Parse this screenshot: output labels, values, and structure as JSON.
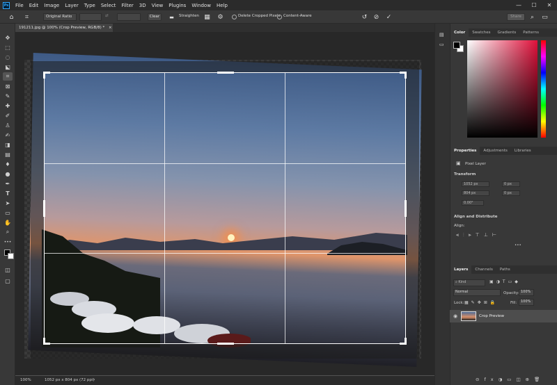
{
  "menubar": {
    "logo": "Ps",
    "items": [
      "File",
      "Edit",
      "Image",
      "Layer",
      "Type",
      "Select",
      "Filter",
      "3D",
      "View",
      "Plugins",
      "Window",
      "Help"
    ],
    "window_controls": [
      "—",
      "☐",
      "✕"
    ]
  },
  "options": {
    "ratio_select": "Original Ratio",
    "clear_label": "Clear",
    "straighten_label": "Straighten",
    "delete_cropped_label": "Delete Cropped Pixels",
    "content_aware_label": "Content-Aware",
    "share_label": "Share"
  },
  "document": {
    "tab_title": "191211.jpg @ 100% (Crop Preview, RGB/8) *",
    "zoom": "100%",
    "dimensions": "1052 px x 804 px (72 ppi)"
  },
  "panels": {
    "color_tabs": [
      "Color",
      "Swatches",
      "Gradients",
      "Patterns"
    ],
    "properties_tabs": [
      "Properties",
      "Adjustments",
      "Libraries"
    ],
    "pixel_layer_label": "Pixel Layer",
    "transform_heading": "Transform",
    "transform_w": "1052 px",
    "transform_h": "804 px",
    "transform_x": "0 px",
    "transform_y": "0 px",
    "transform_angle": "0.00°",
    "align_heading": "Align and Distribute",
    "align_label": "Align:",
    "more": "•••",
    "layers_tabs": [
      "Layers",
      "Channels",
      "Paths"
    ],
    "kind_label": "Kind",
    "blend_mode": "Normal",
    "opacity_label": "Opacity:",
    "opacity_value": "100%",
    "lock_label": "Lock:",
    "fill_label": "Fill:",
    "fill_value": "100%",
    "layer_name": "Crop Preview"
  },
  "colors": {
    "accent": "#31a8ff",
    "foreground": "#000000",
    "background": "#ffffff"
  },
  "icons": {
    "toolbar": [
      "move-icon",
      "marquee-icon",
      "lasso-icon",
      "object-select-icon",
      "crop-icon",
      "frame-icon",
      "eyedropper-icon",
      "healing-icon",
      "brush-icon",
      "stamp-icon",
      "history-brush-icon",
      "eraser-icon",
      "gradient-icon",
      "blur-icon",
      "dodge-icon",
      "pen-icon",
      "type-icon",
      "path-select-icon",
      "rectangle-icon",
      "hand-icon",
      "zoom-icon"
    ]
  }
}
